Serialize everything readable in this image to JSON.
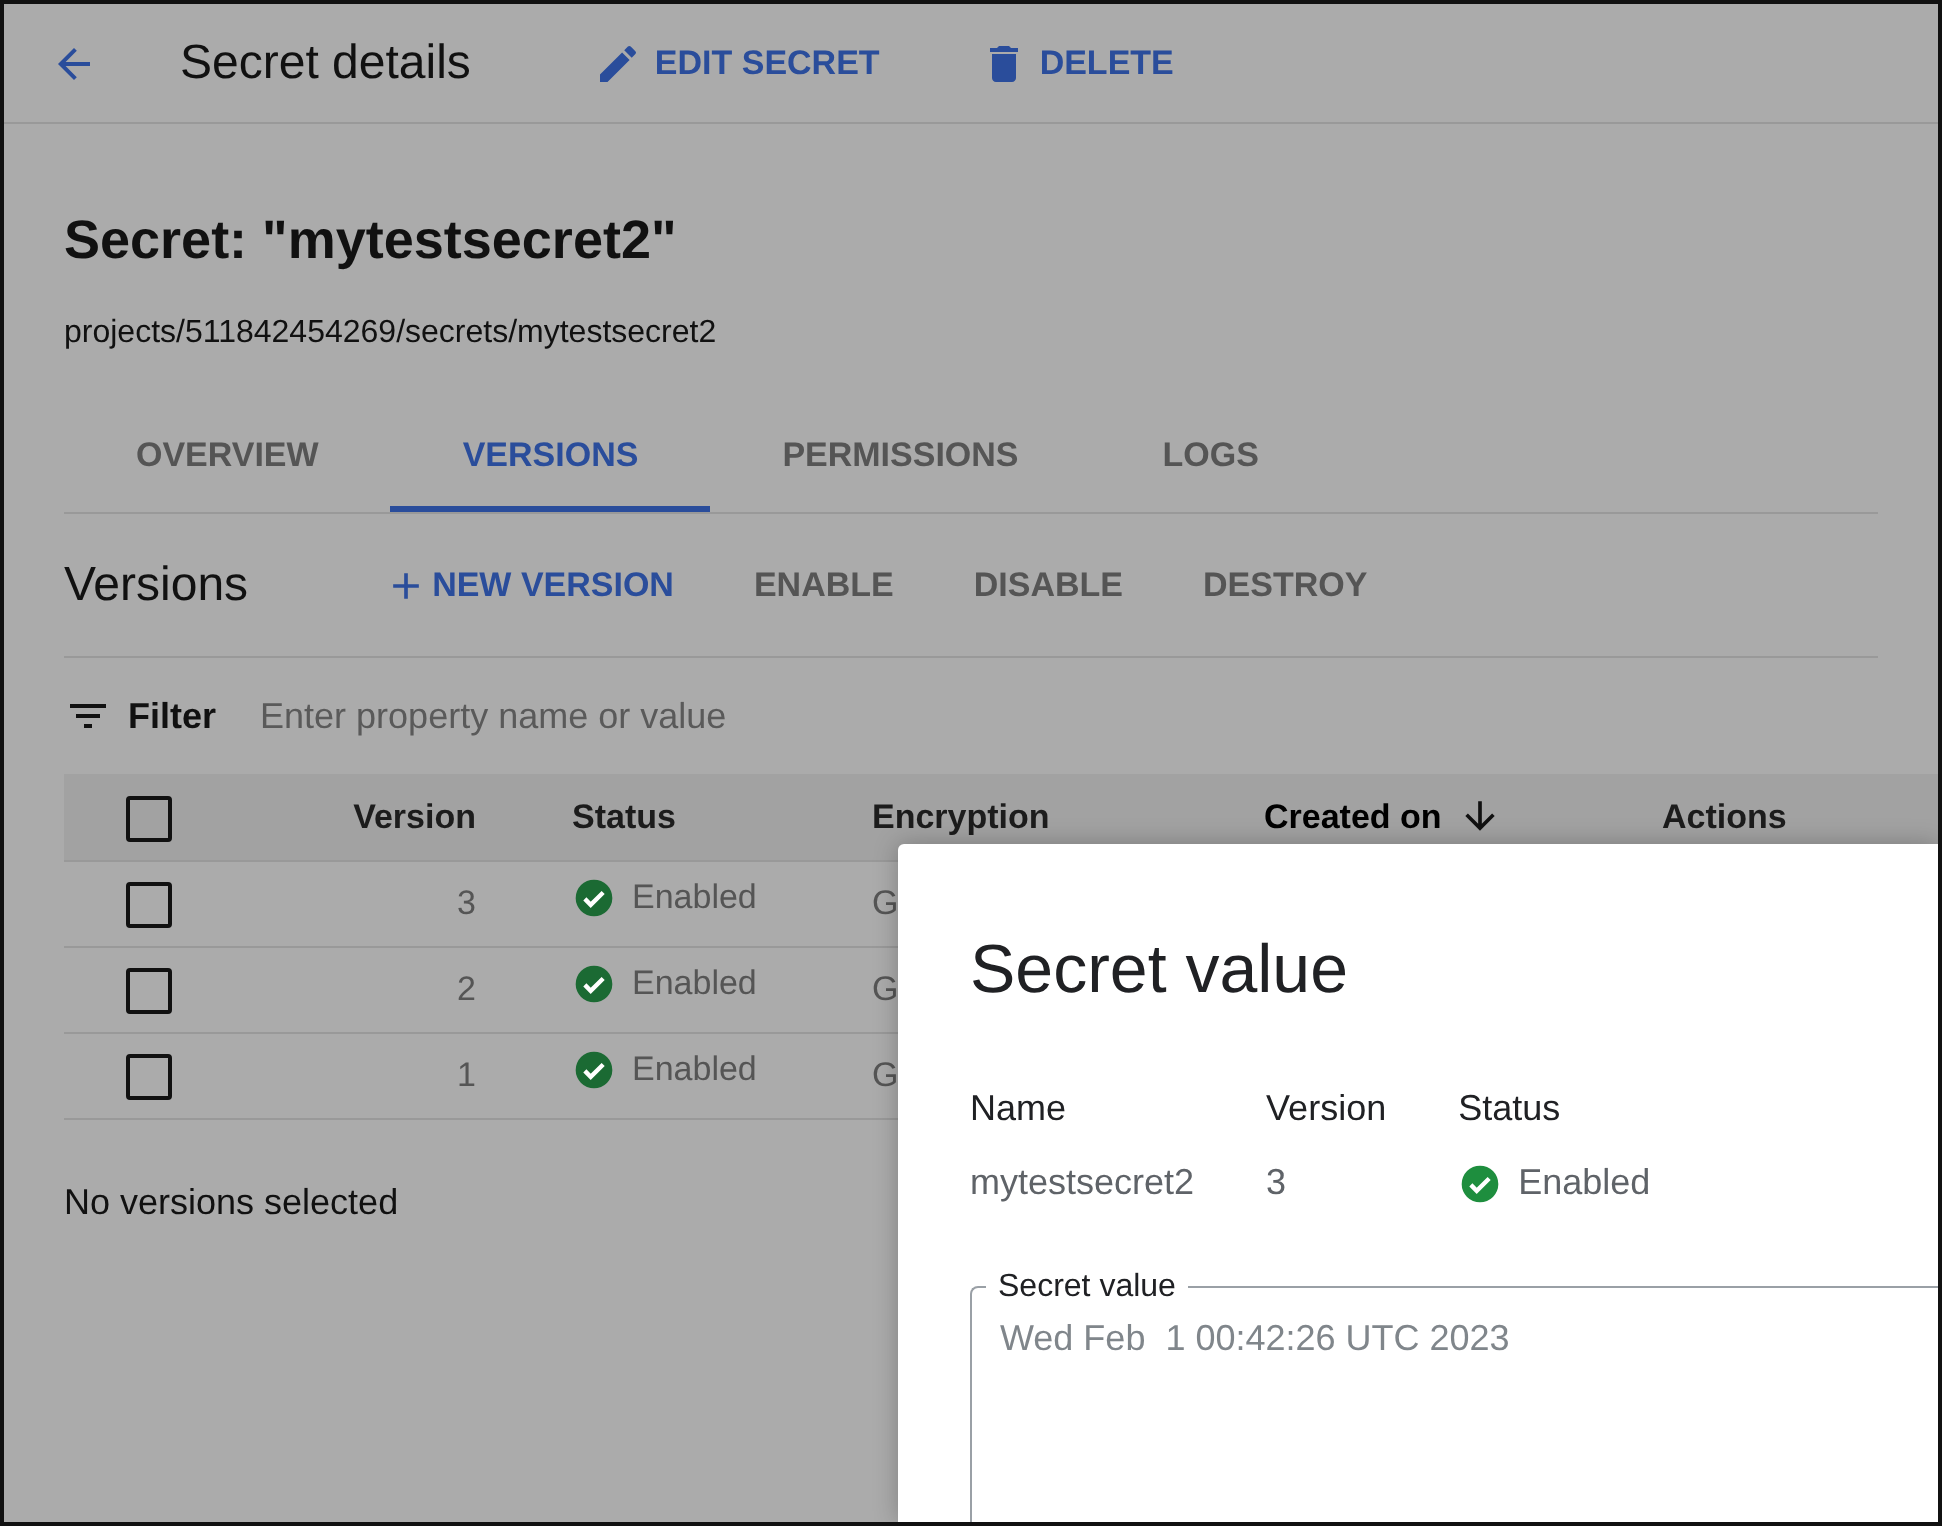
{
  "header": {
    "title": "Secret details",
    "actions": [
      {
        "label": "EDIT SECRET",
        "kind": "edit"
      },
      {
        "label": "DELETE",
        "kind": "delete"
      }
    ]
  },
  "secret": {
    "title": "Secret: \"mytestsecret2\"",
    "path": "projects/511842454269/secrets/mytestsecret2"
  },
  "tabs": [
    {
      "label": "OVERVIEW",
      "selected": false
    },
    {
      "label": "VERSIONS",
      "selected": true
    },
    {
      "label": "PERMISSIONS",
      "selected": false
    },
    {
      "label": "LOGS",
      "selected": false
    }
  ],
  "versions": {
    "title": "Versions",
    "actions": [
      {
        "label": "NEW VERSION",
        "kind": "add",
        "disabled": false
      },
      {
        "label": "ENABLE",
        "kind": "plain",
        "disabled": true
      },
      {
        "label": "DISABLE",
        "kind": "plain",
        "disabled": true
      },
      {
        "label": "DESTROY",
        "kind": "plain",
        "disabled": true
      }
    ]
  },
  "filter": {
    "label": "Filter",
    "placeholder": "Enter property name or value"
  },
  "table": {
    "header_checked": false,
    "columns": [
      {
        "label": "Version",
        "sorted": false
      },
      {
        "label": "Status",
        "sorted": false
      },
      {
        "label": "Encryption",
        "sorted": false
      },
      {
        "label": "Created on",
        "sorted": true
      },
      {
        "label": "Actions",
        "sorted": false
      }
    ],
    "rows": [
      {
        "checked": false,
        "version": "3",
        "status": "Enabled",
        "encryption": "G"
      },
      {
        "checked": false,
        "version": "2",
        "status": "Enabled",
        "encryption": "G"
      },
      {
        "checked": false,
        "version": "1",
        "status": "Enabled",
        "encryption": "G"
      }
    ]
  },
  "selection_text": "No versions selected",
  "dialog": {
    "title": "Secret value",
    "fields": [
      {
        "label": "Name",
        "value": "mytestsecret2",
        "kind": "text"
      },
      {
        "label": "Version",
        "value": "3",
        "kind": "text"
      },
      {
        "label": "Status",
        "value": "Enabled",
        "kind": "status"
      }
    ],
    "secret_value": {
      "label": "Secret value",
      "value": "Wed Feb  1 00:42:26 UTC 2023"
    }
  }
}
